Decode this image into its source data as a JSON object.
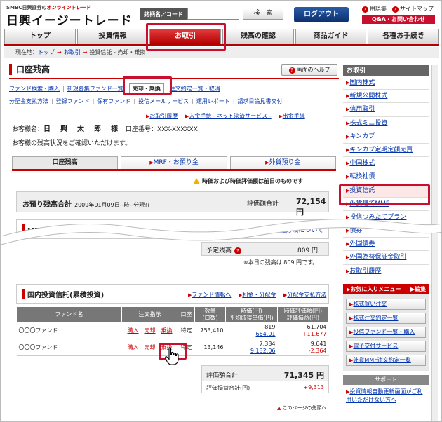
{
  "brand": {
    "sub_prefix": "SMBC日興証券の",
    "sub_highlight": "オンライントレード",
    "main": "日興イージートレード"
  },
  "search": {
    "label": "銘柄名／コード",
    "button": "検　索",
    "placeholder": ""
  },
  "logout": "ログアウト",
  "toplinks": {
    "glossary": "用語集",
    "sitemap": "サイトマップ",
    "qa": "Q&A・お問い合わせ"
  },
  "nav": [
    "トップ",
    "投資情報",
    "お取引",
    "残高の確認",
    "商品ガイド",
    "各種お手続き"
  ],
  "breadcrumb": {
    "prefix": "現在地：",
    "top": "トップ",
    "trade": "お取引",
    "current": "投資信託 - 売却・乗換"
  },
  "page": {
    "title": "口座残高",
    "help": "画面のヘルプ"
  },
  "sublinks1": [
    "ファンド検索・購入",
    "新規募集ファンド一覧",
    "売却・乗換",
    "注文約定一覧・取消"
  ],
  "sublinks2": [
    "分配金支払方法",
    "登録ファンド",
    "保有ファンド",
    "投信メールサービス",
    "運用レポート",
    "請求目論見書交付"
  ],
  "toolrow": [
    "お取引履歴",
    "入金手続 - ネット決済サービス -",
    "出金手続"
  ],
  "customer": {
    "label": "お客様名：",
    "name": "日　興　太　郎　様",
    "account": "口座番号：XXX-XXXXXX"
  },
  "message": "お客様の残高状況をご確認いただけます。",
  "subtabs": [
    "口座残高",
    "MRF・お預り金",
    "外貨預り金"
  ],
  "notice": "時価および時価評価額は前日のものです",
  "total": {
    "label": "お預り残高合計",
    "date": "2009年01月09日--時--分現在",
    "eval_label": "評価額合計",
    "value": "72,154 円"
  },
  "mrf": {
    "title": "MRF・お預り金",
    "link": "入金方法について"
  },
  "yotei": {
    "label": "予定残高",
    "value": "809 円"
  },
  "note": "※本日の残高は 809 円です。",
  "fund": {
    "title": "国内投資信託(累積投資)",
    "links": [
      "ファンド情報へ",
      "利金・分配金",
      "分配金支払方法"
    ]
  },
  "table": {
    "headers": [
      "ファンド名",
      "注文指示",
      "口座",
      "数量\n(口数)",
      "時価(円)\n平均取得単価(円)",
      "時価評価額(円)\n評価損益(円)"
    ],
    "rows": [
      {
        "name": "〇〇〇ファンド",
        "buy": "購入",
        "sell": "売却",
        "switch": "乗換",
        "acct": "特定",
        "qty": "753,410",
        "price": "819",
        "avg": "664.01",
        "eval": "61,704",
        "pl": "+11,677"
      },
      {
        "name": "〇〇〇ファンド",
        "buy": "購入",
        "sell": "売却",
        "switch": "乗換",
        "acct": "特定",
        "qty": "13,146",
        "price": "7,334",
        "avg": "9,132.06",
        "eval": "9,641",
        "pl": "-2,364"
      }
    ]
  },
  "evaluation": {
    "label": "評価額合計",
    "value": "71,345 円",
    "pl_label": "評価損益合計(円)",
    "pl_value": "+9,313"
  },
  "pagetop": "このページの先頭へ",
  "sidebar": {
    "head": "お取引",
    "items": [
      "国内株式",
      "新規公開株式",
      "信用取引",
      "株式ミニ投資",
      "キンカブ",
      "キンカブ定期定額売買",
      "中国株式",
      "転換社債",
      "投資信託",
      "外貨建てMMF",
      "投信つみたてプラン",
      "債券",
      "外国債券",
      "外国為替保証金取引",
      "お取引履歴"
    ],
    "fav_title": "お気に入りメニュー",
    "fav_edit": "編集",
    "fav_items": [
      "株式買い注文",
      "株式注文約定一覧",
      "投信ファンド一覧・購入",
      "電子交付サービス",
      "外貨MMF注文約定一覧"
    ],
    "support": "サポート",
    "support_item": "投資情報自動更新画面がご利用いただけない方へ"
  },
  "colors": {
    "accent": "#c8102e",
    "link": "#0033aa",
    "logout": "#0b2f6c"
  }
}
